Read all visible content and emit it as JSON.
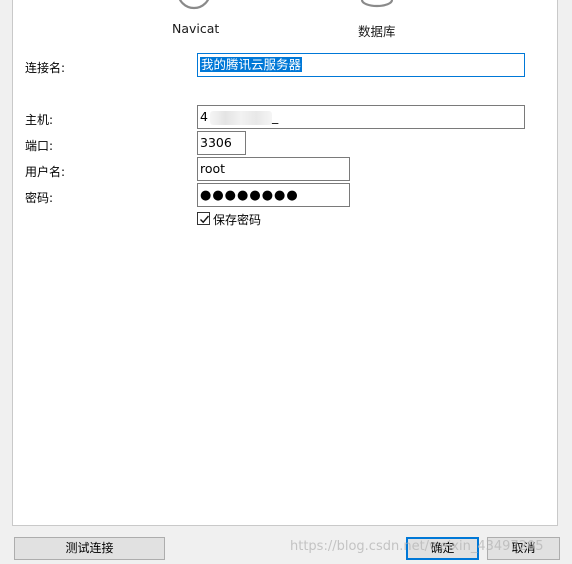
{
  "header": {
    "left_icon": "navicat-icon",
    "left_label": "Navicat",
    "right_icon": "database-icon",
    "right_label": "数据库"
  },
  "form": {
    "connection_name": {
      "label": "连接名:",
      "value": "我的腾讯云服务器"
    },
    "host": {
      "label": "主机:",
      "value_prefix": "4",
      "value_suffix": "_"
    },
    "port": {
      "label": "端口:",
      "value": "3306"
    },
    "username": {
      "label": "用户名:",
      "value": "root"
    },
    "password": {
      "label": "密码:",
      "value": "●●●●●●●●"
    },
    "save_password": {
      "label": "保存密码",
      "checked": true
    }
  },
  "buttons": {
    "test_connection": "测试连接",
    "ok": "确定",
    "cancel": "取消"
  },
  "watermark": "https://blog.csdn.net/weixin_43497205",
  "colors": {
    "accent": "#0078d7",
    "panel_bg": "#ffffff",
    "window_bg": "#f0f0f0",
    "button_bg": "#e1e1e1"
  }
}
